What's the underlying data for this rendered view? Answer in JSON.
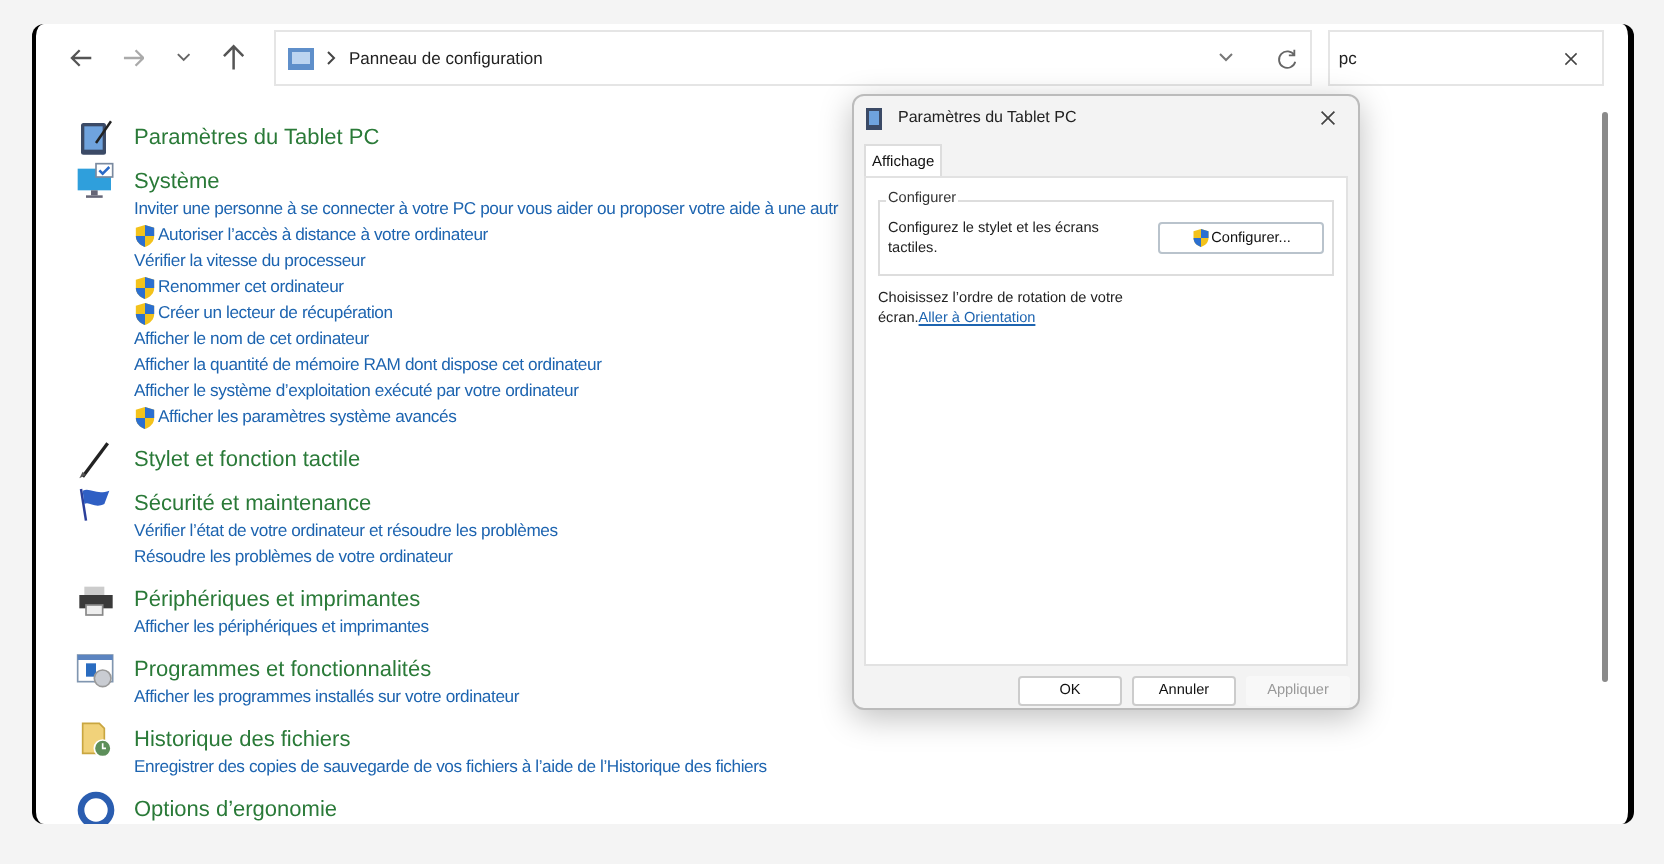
{
  "toolbar": {
    "address": "Panneau de configuration",
    "search_value": "pc"
  },
  "categories": [
    {
      "title": "Paramètres du Tablet PC"
    },
    {
      "title": "Système",
      "links": [
        {
          "text": "Inviter une personne à se connecter à votre PC pour vous aider ou proposer votre aide à une autr",
          "shield": false
        },
        {
          "text": "Autoriser l’accès à distance à votre ordinateur",
          "shield": true
        },
        {
          "text": "Vérifier la vitesse du processeur",
          "shield": false
        },
        {
          "text": "Renommer cet ordinateur",
          "shield": true
        },
        {
          "text": "Créer un lecteur de récupération",
          "shield": true
        },
        {
          "text": "Afficher le nom de cet ordinateur",
          "shield": false
        },
        {
          "text": "Afficher la quantité de mémoire RAM dont dispose cet ordinateur",
          "shield": false
        },
        {
          "text": "Afficher le système d’exploitation exécuté par votre ordinateur",
          "shield": false
        },
        {
          "text": "Afficher les paramètres système avancés",
          "shield": true
        }
      ]
    },
    {
      "title": "Stylet et fonction tactile"
    },
    {
      "title": "Sécurité et maintenance",
      "links": [
        {
          "text": "Vérifier l’état de votre ordinateur et résoudre les problèmes",
          "shield": false
        },
        {
          "text": "Résoudre les problèmes de votre ordinateur",
          "shield": false
        }
      ]
    },
    {
      "title": "Périphériques et imprimantes",
      "links": [
        {
          "text": "Afficher les périphériques et imprimantes",
          "shield": false
        }
      ]
    },
    {
      "title": "Programmes et fonctionnalités",
      "links": [
        {
          "text": "Afficher les programmes installés sur votre ordinateur",
          "shield": false
        }
      ]
    },
    {
      "title": "Historique des fichiers",
      "links": [
        {
          "text": "Enregistrer des copies de sauvegarde de vos fichiers à l’aide de l’Historique des fichiers",
          "shield": false
        }
      ]
    },
    {
      "title": "Options d’ergonomie"
    }
  ],
  "dialog": {
    "title": "Paramètres du Tablet PC",
    "tabs": [
      {
        "label": "Affichage",
        "selected": true
      }
    ],
    "group": {
      "title": "Configurer",
      "text": "Configurez le stylet et les écrans tactiles.",
      "button": "Configurer..."
    },
    "rotation_text": "Choisissez l’ordre de rotation de votre écran.",
    "rotation_link": "Aller à Orientation",
    "buttons": [
      {
        "label": "OK",
        "disabled": false
      },
      {
        "label": "Annuler",
        "disabled": false
      },
      {
        "label": "Appliquer",
        "disabled": true
      }
    ]
  }
}
